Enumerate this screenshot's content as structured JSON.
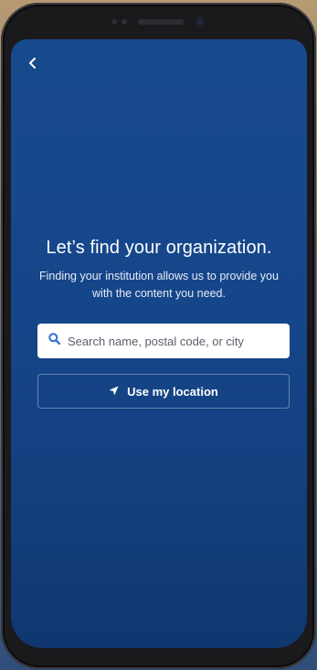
{
  "device": {
    "frame_color": "#1a1a1c",
    "screen_color": "#174a8d"
  },
  "nav": {
    "back_icon": "chevron-left-icon"
  },
  "main": {
    "title": "Let’s find your organization.",
    "subtitle": "Finding your institution allows us to provide you with the content you need."
  },
  "search": {
    "icon": "search-icon",
    "placeholder": "Search name, postal code, or city",
    "value": ""
  },
  "location_button": {
    "icon": "location-arrow-icon",
    "label": "Use my location"
  },
  "colors": {
    "accent": "#2b6fd6",
    "text_on_primary": "#ffffff"
  }
}
